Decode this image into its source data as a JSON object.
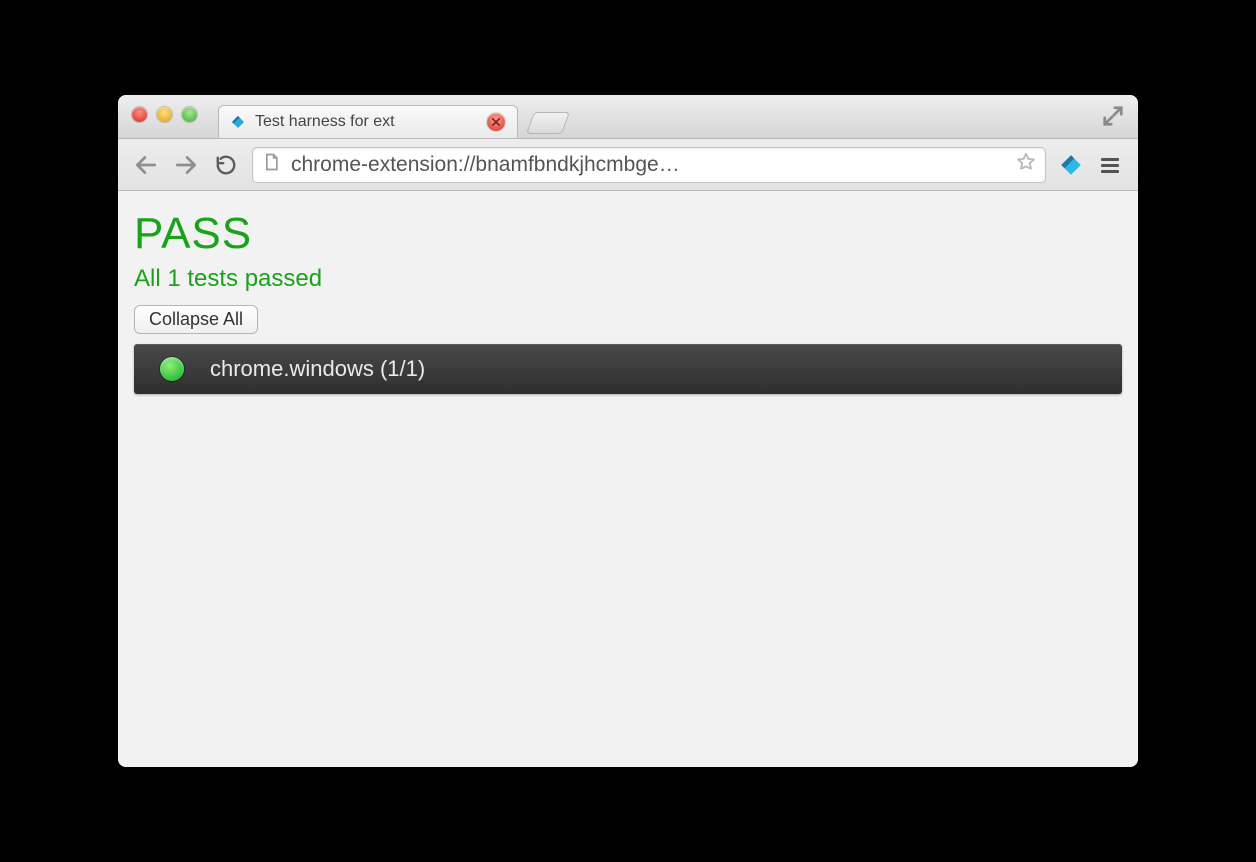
{
  "window": {
    "tab_title": "Test harness for ext",
    "favicon_label": "DART"
  },
  "toolbar": {
    "url": "chrome-extension://bnamfbndkjhcmbge…"
  },
  "content": {
    "status_heading": "PASS",
    "status_sub": "All 1 tests passed",
    "collapse_label": "Collapse All",
    "groups": [
      {
        "label": "chrome.windows (1/1)",
        "status": "pass"
      }
    ]
  }
}
